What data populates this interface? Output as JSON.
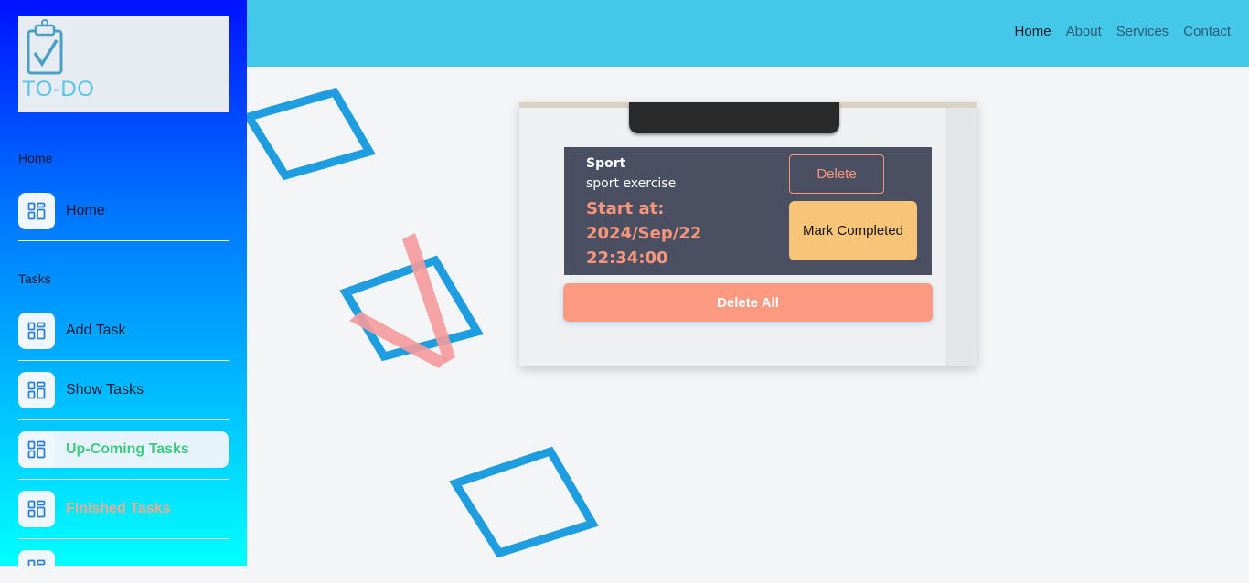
{
  "sidebar": {
    "logo_text": "TO-DO",
    "sections": [
      "Home",
      "Tasks"
    ],
    "items": [
      {
        "label": "Home",
        "icon": "dashboard-icon"
      },
      {
        "label": "Add Task",
        "icon": "dashboard-icon"
      },
      {
        "label": "Show Tasks",
        "icon": "dashboard-icon"
      },
      {
        "label": "Up-Coming Tasks",
        "icon": "dashboard-icon"
      },
      {
        "label": "Finished Tasks",
        "icon": "dashboard-icon"
      }
    ]
  },
  "header": {
    "nav": [
      "Home",
      "About",
      "Services",
      "Contact"
    ]
  },
  "task": {
    "title": "Sport",
    "description": "sport exercise",
    "start": "Start at: 2024/Sep/22 22:34:00",
    "delete_label": "Delete",
    "mark_label": "Mark Completed"
  },
  "delete_all_label": "Delete All",
  "colors": {
    "header": "#44c8ea",
    "accent_salmon": "#f9967c",
    "accent_yellow": "#f8c477",
    "active_green": "#3ecb80",
    "card_dark": "#4a5062"
  }
}
